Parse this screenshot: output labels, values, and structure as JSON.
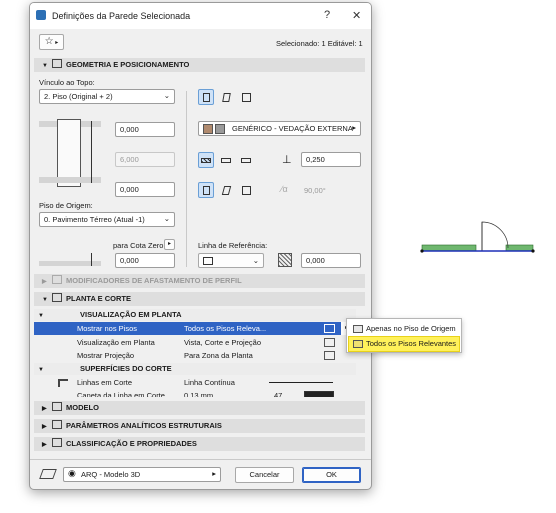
{
  "window": {
    "title": "Definições da Parede Selecionada",
    "help_label": "?",
    "close_label": "✕",
    "selection_info": "Selecionado: 1 Editável: 1"
  },
  "sections": {
    "geometry": "GEOMETRIA E POSICIONAMENTO",
    "profile_mods": "MODIFICADORES DE AFASTAMENTO DE PERFIL",
    "plan_section": "PLANTA E CORTE",
    "model": "MODELO",
    "structural": "PARÂMETROS ANALÍTICOS ESTRUTURAIS",
    "classification": "CLASSIFICAÇÃO E PROPRIEDADES"
  },
  "geometry": {
    "top_link_label": "Vínculo ao Topo:",
    "top_link_value": "2. Piso (Original + 2)",
    "top_offset": "0,000",
    "height": "6,000",
    "bottom_offset": "0,000",
    "home_story_label": "Piso de Origem:",
    "home_story_value": "0. Pavimento Térreo (Atual -1)",
    "to_zero_label": "para Cota Zero",
    "to_zero_value": "0,000",
    "material": "GENÉRICO - VEDAÇÃO EXTERNA",
    "thickness": "0,250",
    "angle": "90,00°",
    "reference_line_label": "Linha de Referência:",
    "reference_offset": "0,000"
  },
  "plan_section": {
    "sub_plan": "VISUALIZAÇÃO EM PLANTA",
    "rows": [
      {
        "label": "Mostrar nos Pisos",
        "value": "Todos os Pisos Releva..."
      },
      {
        "label": "Visualização em Planta",
        "value": "Vista, Corte e Projeção"
      },
      {
        "label": "Mostrar Projeção",
        "value": "Para Zona da Planta"
      }
    ],
    "sub_cut": "SUPERFÍCIES DO CORTE",
    "cut_rows": [
      {
        "label": "Linhas em Corte",
        "value": "Linha Contínua",
        "extra": ""
      },
      {
        "label": "Caneta da Linha em Corte",
        "value": "0,13 mm",
        "extra": "47"
      }
    ]
  },
  "popup": {
    "items": [
      "Apenas no Piso de Origem",
      "Todos os Pisos Relevantes"
    ]
  },
  "footer": {
    "layer": "ARQ - Modelo 3D",
    "cancel": "Cancelar",
    "ok": "OK"
  },
  "colors": {
    "selection_blue": "#2f63c4",
    "highlight_yellow": "#fff15a",
    "preview_green": "#6fb76f",
    "preview_line": "#1d2fb8"
  }
}
